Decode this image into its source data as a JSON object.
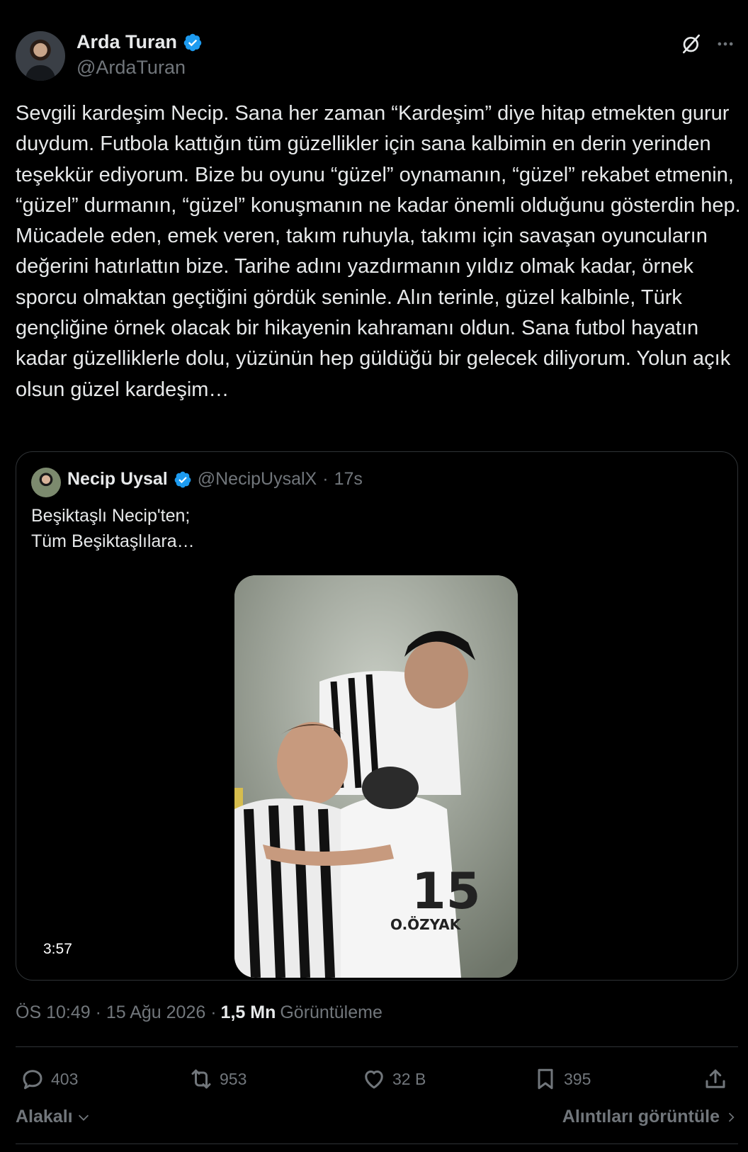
{
  "author": {
    "display_name": "Arda Turan",
    "handle": "@ArdaTuran",
    "verified": true,
    "verified_color": "#1d9bf0"
  },
  "tweet": {
    "text": "Sevgili kardeşim Necip. Sana her zaman “Kardeşim” diye hitap etmekten gurur duydum. Futbola kattığın tüm güzellikler için sana kalbimin en derin yerinden teşekkür ediyorum. Bize bu oyunu “güzel” oynamanın, “güzel” rekabet etmenin, “güzel” durmanın, “güzel” konuşmanın ne kadar önemli olduğunu gösterdin hep. Mücadele eden, emek veren, takım ruhuyla, takımı için savaşan oyuncuların değerini hatırlattın bize. Tarihe adını yazdırmanın yıldız olmak kadar, örnek sporcu olmaktan geçtiğini gördük seninle. Alın terinle, güzel kalbinle, Türk gençliğine örnek olacak bir hikayenin kahramanı oldun. Sana futbol hayatın kadar güzelliklerle dolu, yüzünün hep güldüğü bir gelecek diliyorum. Yolun açık olsun güzel kardeşim…"
  },
  "quote": {
    "display_name": "Necip Uysal",
    "handle": "@NecipUysalX",
    "separator": "·",
    "time": "17s",
    "line1": "Beşiktaşlı Necip'ten;",
    "line2": "Tüm Beşiktaşlılara…",
    "video_duration": "3:57",
    "jersey_name": "O.ÖZYAK",
    "jersey_number": "15"
  },
  "meta": {
    "timestamp": "ÖS 10:49 · 15 Ağu 2026 ·",
    "views_count": "1,5 Mn",
    "views_label": "Görüntüleme"
  },
  "actions": {
    "replies": "403",
    "reposts": "953",
    "likes": "32 B",
    "bookmarks": "395"
  },
  "footer": {
    "sort_label": "Alakalı",
    "quotes_label": "Alıntıları görüntüle"
  },
  "colors": {
    "background": "#000000",
    "text_primary": "#e7e9ea",
    "text_secondary": "#71767b",
    "border": "#2f3336"
  }
}
